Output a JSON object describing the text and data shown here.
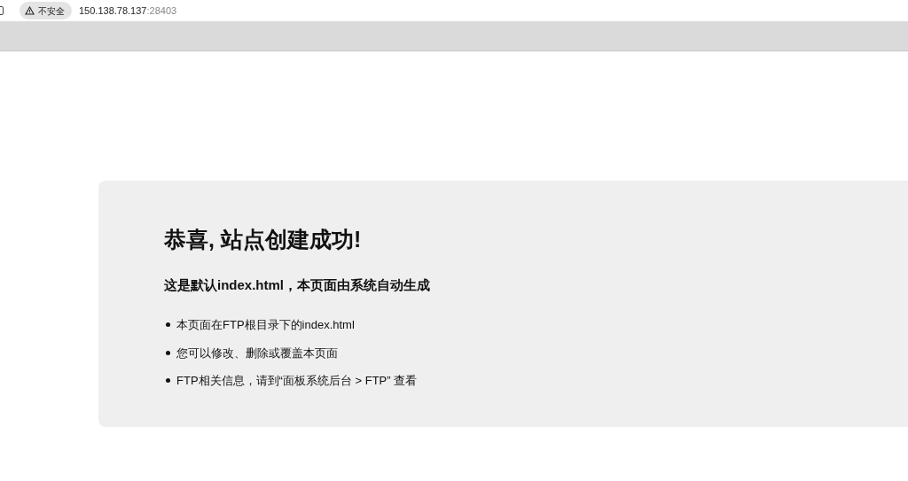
{
  "browser": {
    "security_label": "不安全",
    "url_host": "150.138.78.137",
    "url_port": ":28403"
  },
  "page": {
    "title": "恭喜, 站点创建成功!",
    "subtitle": "这是默认index.html，本页面由系统自动生成",
    "items": [
      "本页面在FTP根目录下的index.html",
      "您可以修改、删除或覆盖本页面",
      "FTP相关信息，请到“面板系统后台 > FTP” 查看"
    ]
  }
}
